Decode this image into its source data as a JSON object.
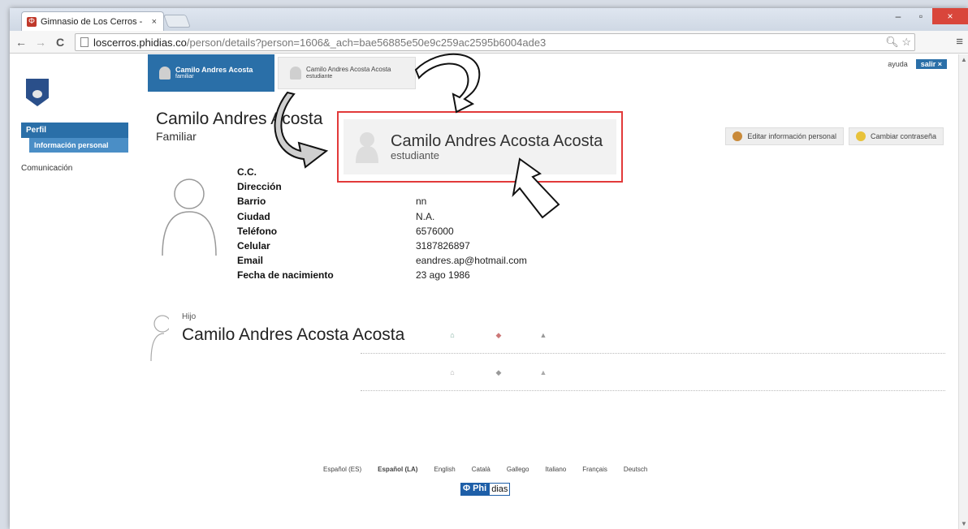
{
  "browser": {
    "tab_title": "Gimnasio de Los Cerros -",
    "tab_close": "×",
    "favicon": "Φ",
    "url_host": "loscerros.phidias.co",
    "url_path": "/person/details?person=1606&_ach=bae56885e50e9c259ac2595b6004ade3",
    "win_min": "–",
    "win_max": "▫",
    "win_close": "×"
  },
  "sidebar": {
    "perfil": "Perfil",
    "info_personal": "Información personal",
    "comunicacion": "Comunicación"
  },
  "profile_tabs": [
    {
      "name": "Camilo Andres Acosta",
      "role": "familiar"
    },
    {
      "name": "Camilo Andres Acosta Acosta",
      "role": "estudiante"
    }
  ],
  "topbar": {
    "help": "ayuda",
    "exit": "salir ×"
  },
  "person": {
    "name": "Camilo Andres Acosta",
    "role": "Familiar"
  },
  "actions": {
    "edit": "Editar información personal",
    "password": "Cambiar contraseña"
  },
  "details": [
    {
      "label": "C.C.",
      "value": ""
    },
    {
      "label": "Dirección",
      "value": ""
    },
    {
      "label": "Barrio",
      "value": "nn"
    },
    {
      "label": "Ciudad",
      "value": "N.A."
    },
    {
      "label": "Teléfono",
      "value": "6576000"
    },
    {
      "label": "Celular",
      "value": "3187826897"
    },
    {
      "label": "Email",
      "value": "eandres.ap@hotmail.com"
    },
    {
      "label": "Fecha de nacimiento",
      "value": "23 ago 1986"
    }
  ],
  "child": {
    "relation": "Hijo",
    "name": "Camilo Andres Acosta Acosta"
  },
  "languages": [
    "Español (ES)",
    "Español (LA)",
    "English",
    "Català",
    "Gallego",
    "Italiano",
    "Français",
    "Deutsch"
  ],
  "selected_language": "Español (LA)",
  "brand": {
    "part1": "Φ Phi",
    "part2": "dias"
  },
  "popup": {
    "name": "Camilo Andres Acosta Acosta",
    "role": "estudiante"
  },
  "colors": {
    "primary": "#2a6fa8",
    "highlight": "#e23a3a"
  }
}
